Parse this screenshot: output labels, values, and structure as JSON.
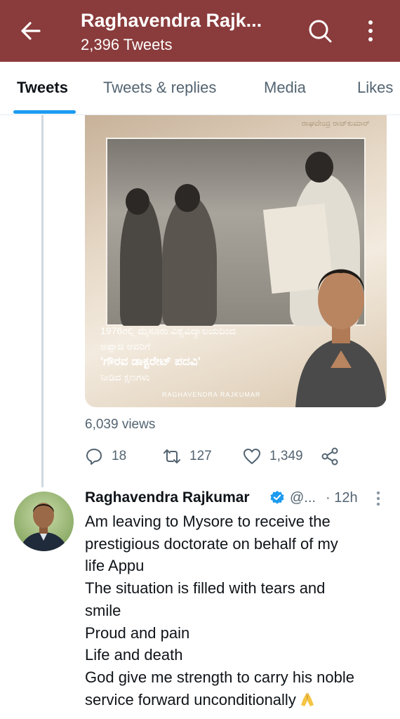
{
  "header": {
    "title": "Raghavendra Rajk...",
    "subtitle": "2,396 Tweets",
    "color": "#8a3b3b"
  },
  "tabs": [
    {
      "label": "Tweets",
      "active": true
    },
    {
      "label": "Tweets & replies",
      "active": false
    },
    {
      "label": "Media",
      "active": false
    },
    {
      "label": "Likes",
      "active": false
    }
  ],
  "media": {
    "watermark": "ರಾಘವೇಂದ್ರ ರಾಜ್‌ಕುಮಾರ್",
    "caption_lines": [
      "1976ರಲ್ಲಿ ಮೈಸೂರು ವಿಶ್ವವಿದ್ಯಾಲಯದಿಂದ",
      "ಅಪ್ಪಾಜಿ ಅವರಿಗೆ",
      "'ಗೌರವ ಡಾಕ್ಟರೇಟ್ ಪದವಿ'",
      "ನೀಡಿದ ಕ್ಷಣಗಳು"
    ],
    "credit": "RAGHAVENDRA RAJKUMAR"
  },
  "previous_tweet": {
    "views": "6,039 views",
    "replies": "18",
    "retweets": "127",
    "likes": "1,349"
  },
  "tweet": {
    "author": "Raghavendra Rajkumar",
    "handle": "@...",
    "time": "· 12h",
    "lines": [
      "Am leaving to Mysore to receive the",
      "prestigious doctorate on behalf of my",
      "life Appu",
      "The situation is filled with tears and",
      "smile",
      "Proud and pain",
      "Life and death",
      "God give me strength to carry his noble",
      "service forward unconditionally"
    ]
  },
  "icons": {
    "back": "arrow-left-icon",
    "search": "search-icon",
    "more": "more-vertical-icon",
    "reply": "reply-icon",
    "retweet": "retweet-icon",
    "like": "heart-icon",
    "share": "share-icon",
    "verified": "verified-badge-icon",
    "emoji": "folded-hands-emoji"
  },
  "colors": {
    "accent": "#1d9bf0",
    "muted": "#536471"
  }
}
